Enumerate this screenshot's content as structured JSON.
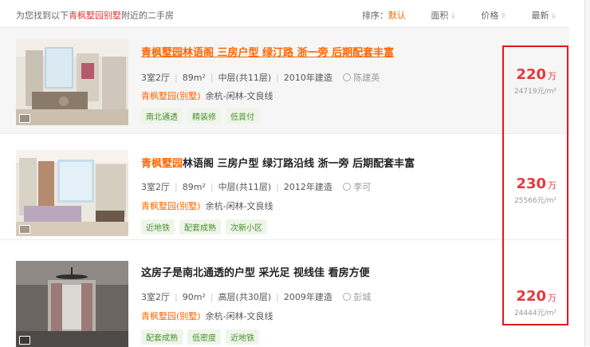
{
  "header": {
    "result_prefix": "为您找到以下",
    "result_keyword": "青枫墅园别墅",
    "result_suffix": "附近的二手房",
    "sort_label": "排序：",
    "sort_options": [
      "默认",
      "面积",
      "价格",
      "最新"
    ],
    "sort_active": "默认"
  },
  "listings": [
    {
      "title": "青枫墅园林语阁 三房户型 绿汀路 浙一旁 后期配套丰富",
      "title_keyword": "",
      "title_rest": "",
      "layout": "3室2厅",
      "area": "89m²",
      "floor": "中层(共11层)",
      "built": "2010年建造",
      "agent": "陈建英",
      "community": "青枫墅园(别墅)",
      "district": "余杭-闲林-文良线",
      "tags": [
        "南北通透",
        "精装修",
        "低首付"
      ],
      "price_total": "220",
      "price_unit": "万",
      "price_per": "24719元/m²"
    },
    {
      "title": "",
      "title_keyword": "青枫墅园",
      "title_rest": "林语阁 三房户型 绿汀路沿线 浙一旁 后期配套丰富",
      "layout": "3室2厅",
      "area": "89m²",
      "floor": "中层(共11层)",
      "built": "2012年建造",
      "agent": "李可",
      "community": "青枫墅园(别墅)",
      "district": "余杭-闲林-文良线",
      "tags": [
        "近地铁",
        "配套成熟",
        "次新小区"
      ],
      "price_total": "230",
      "price_unit": "万",
      "price_per": "25566元/m²"
    },
    {
      "title": "这房子是南北通透的户型 采光足 视线佳 看房方便",
      "title_keyword": "",
      "title_rest": "",
      "layout": "3室2厅",
      "area": "90m²",
      "floor": "高层(共30层)",
      "built": "2009年建造",
      "agent": "彭城",
      "community": "青枫墅园(别墅)",
      "district": "余杭-闲林-文良线",
      "tags": [
        "配套成熟",
        "低密度",
        "近地铁"
      ],
      "price_total": "220",
      "price_unit": "万",
      "price_per": "24444元/m²"
    }
  ],
  "colors": {
    "accent": "#f60",
    "price": "#e4393c",
    "highlight_box": "#e8151b"
  }
}
